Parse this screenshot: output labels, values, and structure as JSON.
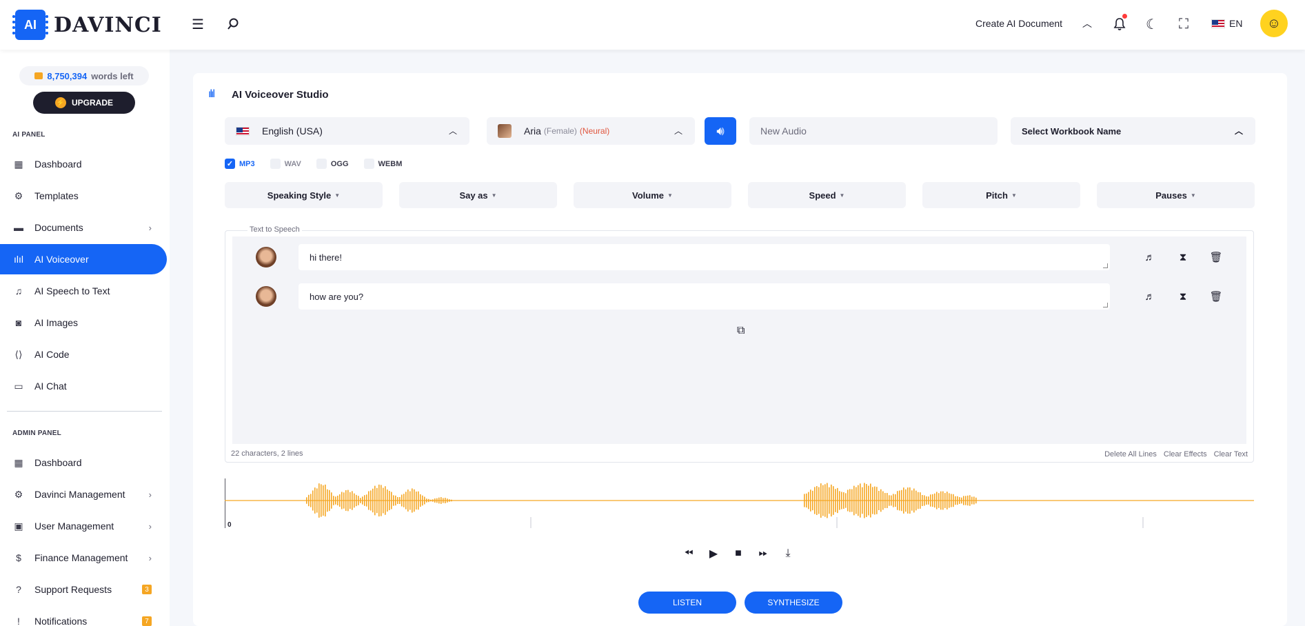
{
  "header": {
    "logo_chip": "AI",
    "logo_text": "DAVINCI",
    "create_doc": "Create AI Document",
    "lang": "EN"
  },
  "sidebar": {
    "words_count": "8,750,394",
    "words_label": "words left",
    "upgrade": "UPGRADE",
    "ai_panel_title": "AI PANEL",
    "ai_items": [
      {
        "label": "Dashboard"
      },
      {
        "label": "Templates"
      },
      {
        "label": "Documents"
      },
      {
        "label": "AI Voiceover"
      },
      {
        "label": "AI Speech to Text"
      },
      {
        "label": "AI Images"
      },
      {
        "label": "AI Code"
      },
      {
        "label": "AI Chat"
      }
    ],
    "admin_panel_title": "ADMIN PANEL",
    "admin_items": [
      {
        "label": "Dashboard"
      },
      {
        "label": "Davinci Management"
      },
      {
        "label": "User Management"
      },
      {
        "label": "Finance Management"
      },
      {
        "label": "Support Requests",
        "badge": "3"
      },
      {
        "label": "Notifications",
        "badge": "7"
      }
    ]
  },
  "studio": {
    "title": "AI Voiceover Studio",
    "language": "English (USA)",
    "voice_name": "Aria",
    "voice_gender": "(Female)",
    "voice_type": "(Neural)",
    "audio_name_placeholder": "New Audio",
    "workbook": "Select Workbook Name",
    "formats": [
      "MP3",
      "WAV",
      "OGG",
      "WEBM"
    ],
    "selected_format": "MP3",
    "options": [
      "Speaking Style",
      "Say as",
      "Volume",
      "Speed",
      "Pitch",
      "Pauses"
    ],
    "tts_legend": "Text to Speech",
    "lines": [
      {
        "text": "hi there!"
      },
      {
        "text": "how are you?"
      }
    ],
    "meta": "22 characters, 2 lines",
    "links": {
      "delete_all": "Delete All Lines",
      "clear_effects": "Clear Effects",
      "clear_text": "Clear Text"
    },
    "wave_start_label": "0",
    "listen": "LISTEN",
    "synthesize": "SYNTHESIZE"
  },
  "colors": {
    "accent": "#1565f5",
    "wave": "#f5a623",
    "dark": "#1e1e2d"
  }
}
